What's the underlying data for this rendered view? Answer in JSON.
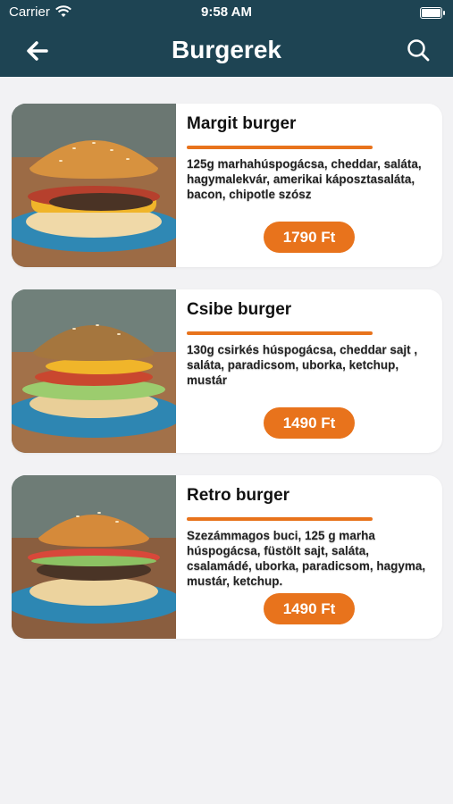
{
  "status": {
    "carrier": "Carrier",
    "time": "9:58 AM"
  },
  "header": {
    "title": "Burgerek"
  },
  "items": [
    {
      "name": "Margit burger",
      "description": "125g marhahúspogácsa, cheddar, saláta, hagymalekvár, amerikai káposztasaláta, bacon, chipotle szósz",
      "price": "1790 Ft"
    },
    {
      "name": "Csibe burger",
      "description": "130g  csirkés húspogácsa, cheddar sajt , saláta, paradicsom, uborka, ketchup, mustár",
      "price": "1490 Ft"
    },
    {
      "name": "Retro burger",
      "description": "Szezámmagos buci, 125 g marha húspogácsa, füstölt sajt, saláta, csalamádé, uborka, paradicsom, hagyma, mustár, ketchup.",
      "price": "1490 Ft"
    }
  ],
  "colors": {
    "nav": "#1e4453",
    "accent": "#e8731c",
    "background": "#f2f2f4"
  },
  "icons": {
    "back": "arrow-left-icon",
    "search": "search-icon",
    "wifi": "wifi-icon",
    "battery": "battery-icon"
  }
}
